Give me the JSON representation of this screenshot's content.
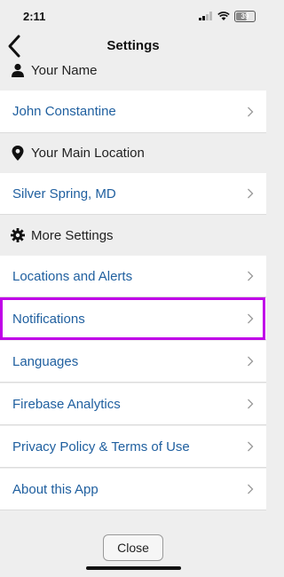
{
  "status_bar": {
    "time": "2:11",
    "battery": "39"
  },
  "nav": {
    "title": "Settings"
  },
  "sections": {
    "name": {
      "header": "Your Name",
      "value": "John Constantine"
    },
    "location": {
      "header": "Your Main Location",
      "value": "Silver Spring, MD"
    },
    "more": {
      "header": "More Settings",
      "items": [
        {
          "label": "Locations and Alerts"
        },
        {
          "label": "Notifications"
        },
        {
          "label": "Languages"
        },
        {
          "label": "Firebase Analytics"
        },
        {
          "label": "Privacy Policy & Terms of Use"
        },
        {
          "label": "About this App"
        }
      ]
    }
  },
  "footer": {
    "close_label": "Close"
  },
  "colors": {
    "link": "#1f5f9f",
    "highlight": "#c000e8",
    "background": "#eeeeee"
  }
}
